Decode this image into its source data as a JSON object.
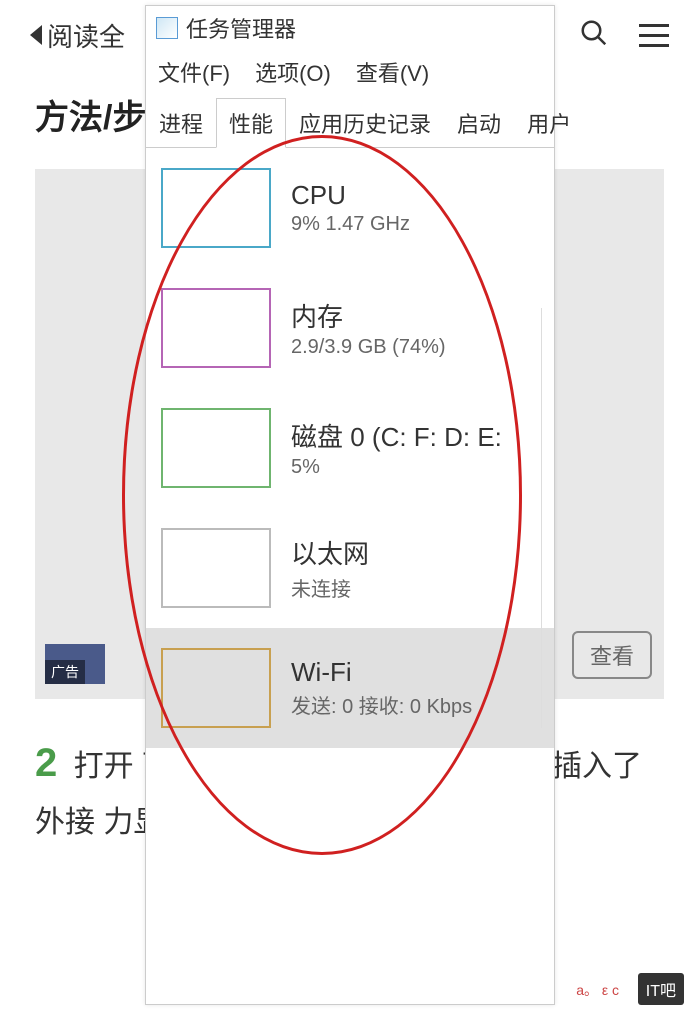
{
  "bg": {
    "back_label": "阅读全",
    "title": "方法/步",
    "ad_label": "广告",
    "view_btn": "查看",
    "step_num": "2",
    "paragraph": "打开                                 面板，我们可                                 CPU、内存、磁                               插入了外接                                 力显",
    "watermark": "IT吧",
    "small_red": "a。 ε  c"
  },
  "tm": {
    "title": "任务管理器",
    "menu": {
      "file": "文件(F)",
      "options": "选项(O)",
      "view": "查看(V)"
    },
    "tabs": {
      "processes": "进程",
      "performance": "性能",
      "history": "应用历史记录",
      "startup": "启动",
      "users": "用户"
    },
    "items": {
      "cpu": {
        "title": "CPU",
        "sub": "9% 1.47 GHz"
      },
      "mem": {
        "title": "内存",
        "sub": "2.9/3.9 GB (74%)"
      },
      "disk": {
        "title": "磁盘 0 (C: F: D: E:",
        "sub": "5%"
      },
      "eth": {
        "title": "以太网",
        "sub": "未连接"
      },
      "wifi": {
        "title": "Wi-Fi",
        "sub": "发送: 0 接收: 0 Kbps"
      }
    }
  }
}
